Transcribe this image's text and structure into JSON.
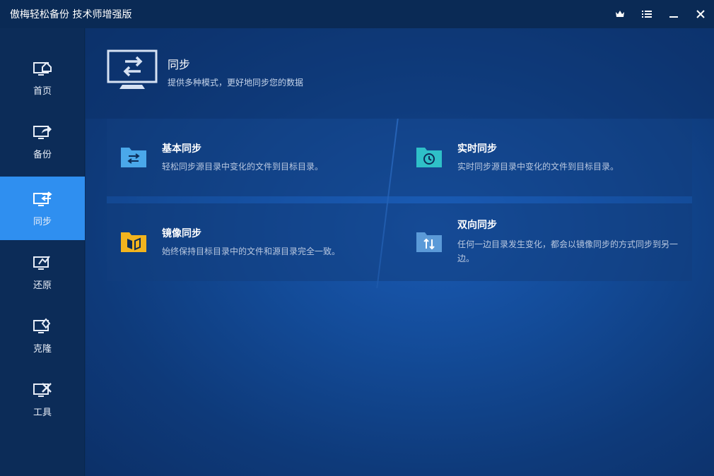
{
  "window": {
    "title": "傲梅轻松备份 技术师增强版",
    "controls": [
      "crown-icon",
      "menu-icon",
      "minimize-icon",
      "close-icon"
    ]
  },
  "sidebar": {
    "items": [
      {
        "label": "首页",
        "icon": "home-monitor-icon",
        "active": false
      },
      {
        "label": "备份",
        "icon": "backup-monitor-icon",
        "active": false
      },
      {
        "label": "同步",
        "icon": "sync-monitor-icon",
        "active": true
      },
      {
        "label": "还原",
        "icon": "restore-monitor-icon",
        "active": false
      },
      {
        "label": "克隆",
        "icon": "clone-monitor-icon",
        "active": false
      },
      {
        "label": "工具",
        "icon": "tools-monitor-icon",
        "active": false
      }
    ]
  },
  "header": {
    "title": "同步",
    "subtitle": "提供多种模式，更好地同步您的数据",
    "icon": "sync-monitor-icon"
  },
  "cards": {
    "basic": {
      "title": "基本同步",
      "desc": "轻松同步源目录中变化的文件到目标目录。",
      "icon": "basic-sync-folder-icon"
    },
    "realtime": {
      "title": "实时同步",
      "desc": "实时同步源目录中变化的文件到目标目录。",
      "icon": "realtime-sync-folder-icon"
    },
    "mirror": {
      "title": "镜像同步",
      "desc": "始终保持目标目录中的文件和源目录完全一致。",
      "icon": "mirror-sync-folder-icon"
    },
    "twoway": {
      "title": "双向同步",
      "desc": "任何一边目录发生变化，都会以镜像同步的方式同步到另一边。",
      "icon": "twoway-sync-folder-icon"
    }
  },
  "colors": {
    "accent": "#2f8ff0",
    "blue_folder": "#4aa8ea",
    "teal_folder": "#2fc0c8",
    "yellow_folder": "#f2b41e",
    "steel_folder": "#5b9ad8"
  }
}
